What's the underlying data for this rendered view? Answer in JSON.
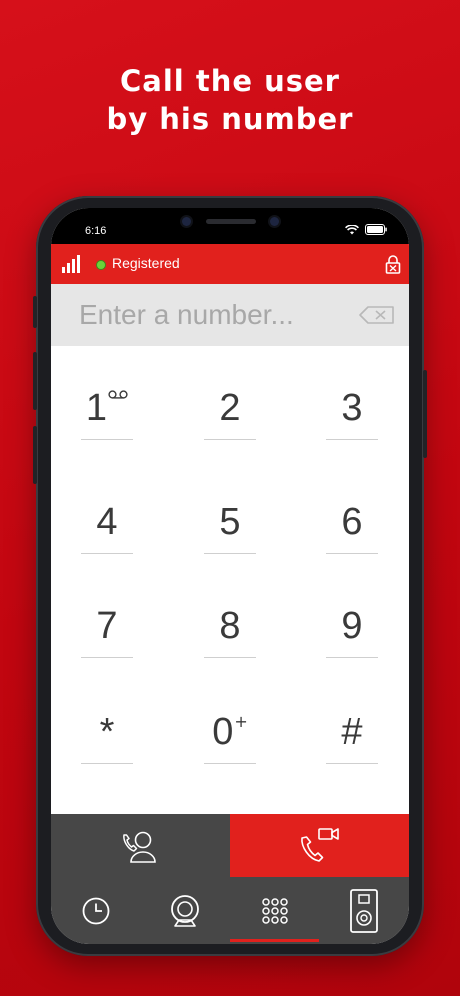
{
  "headline": {
    "line1": "Call the user",
    "line2": "by his number"
  },
  "status_bar": {
    "time": "6:16"
  },
  "header": {
    "registration_status": "Registered"
  },
  "dialer": {
    "placeholder": "Enter a number..."
  },
  "keypad": {
    "keys": [
      {
        "digit": "1",
        "sub": ""
      },
      {
        "digit": "2",
        "sub": ""
      },
      {
        "digit": "3",
        "sub": ""
      },
      {
        "digit": "4",
        "sub": ""
      },
      {
        "digit": "5",
        "sub": ""
      },
      {
        "digit": "6",
        "sub": ""
      },
      {
        "digit": "7",
        "sub": ""
      },
      {
        "digit": "8",
        "sub": ""
      },
      {
        "digit": "9",
        "sub": ""
      },
      {
        "digit": "*",
        "sub": ""
      },
      {
        "digit": "0",
        "sub": "+"
      },
      {
        "digit": "#",
        "sub": ""
      }
    ]
  },
  "tabs": {
    "icons": [
      "clock-icon",
      "webcam-icon",
      "keypad-icon",
      "intercom-icon"
    ],
    "selected_index": 2
  },
  "colors": {
    "brand_red": "#e1211d",
    "dark_gray": "#474747",
    "registered_green": "#6bd339"
  }
}
